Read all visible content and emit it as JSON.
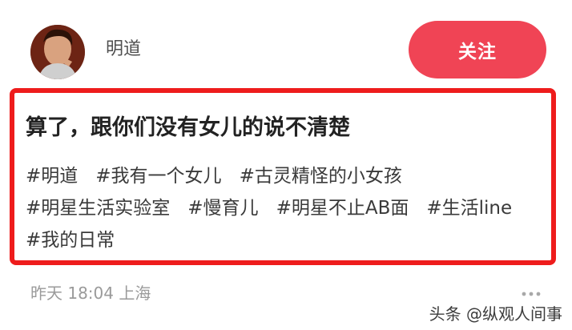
{
  "post": {
    "author": {
      "name": "明道",
      "follow_label": "关注"
    },
    "title": "算了，跟你们没有女儿的说不清楚",
    "tags": [
      "#明道",
      "#我有一个女儿",
      "#古灵精怪的小女孩",
      "#明星生活实验室",
      "#慢育儿",
      "#明星不止AB面",
      "#生活line",
      "#我的日常"
    ],
    "meta": "昨天 18:04 上海",
    "more_icon": "more-horizontal-icon"
  },
  "watermark": "头条 @纵观人间事",
  "colors": {
    "follow_button": "#f04455",
    "highlight_border": "#ee1c1c"
  }
}
